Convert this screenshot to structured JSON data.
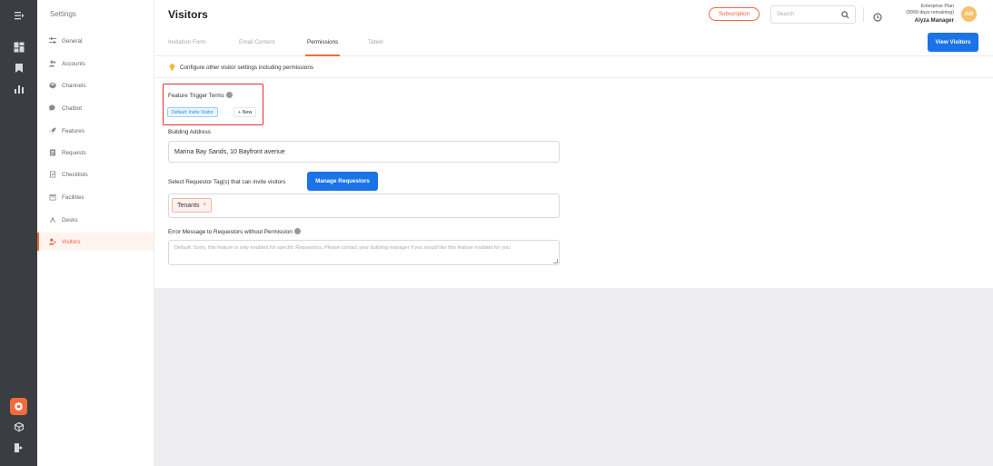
{
  "rail": {
    "icons": [
      "collapse-icon",
      "dashboard-icon",
      "bookmark-icon",
      "analytics-icon",
      "settings-icon",
      "cube-icon",
      "logout-icon"
    ]
  },
  "sidebar": {
    "title": "Settings",
    "items": [
      {
        "label": "General",
        "icon": "sliders-icon"
      },
      {
        "label": "Accounts",
        "icon": "users-icon"
      },
      {
        "label": "Channels",
        "icon": "box-icon"
      },
      {
        "label": "Chatbot",
        "icon": "chat-icon"
      },
      {
        "label": "Features",
        "icon": "rocket-icon"
      },
      {
        "label": "Requests",
        "icon": "document-icon"
      },
      {
        "label": "Checklists",
        "icon": "checklist-icon"
      },
      {
        "label": "Facilities",
        "icon": "calendar-icon"
      },
      {
        "label": "Desks",
        "icon": "desk-icon"
      },
      {
        "label": "Visitors",
        "icon": "visitors-icon",
        "active": true
      }
    ]
  },
  "header": {
    "title": "Visitors",
    "subscription_label": "Subscription",
    "search_placeholder": "Search",
    "plan_line1": "Enterprise Plan",
    "plan_line2": "(9999 days remaining)",
    "user_name": "Alyza Manager",
    "avatar_initials": "AM"
  },
  "tabs": {
    "items": [
      "Invitation Form",
      "Email Content",
      "Permissions",
      "Tablet"
    ],
    "active": "Permissions",
    "view_button": "View Visitors"
  },
  "info": {
    "text": "Configure other visitor settings including permissions"
  },
  "form": {
    "trigger_label": "Feature Trigger Terms",
    "trigger_chip": "Default: Invite Visitor",
    "new_label": "+ New",
    "address_label": "Building Address",
    "address_value": "Marina Bay Sands, 10 Bayfront avenue",
    "requestor_label": "Select Requestor Tag(s) that can invite visitors",
    "manage_button": "Manage Requestors",
    "tag_value": "Tenants",
    "tag_remove": "×",
    "error_label": "Error Message to Requestors without Permission",
    "error_placeholder": "Default: Sorry, this feature is only enabled for specific Requestors. Please contact your building manager if you would like this feature enabled for you."
  },
  "colors": {
    "accent": "#f26b3a",
    "primary": "#1a73e8",
    "rail": "#3a3d42",
    "highlight_border": "#e52d2d"
  }
}
